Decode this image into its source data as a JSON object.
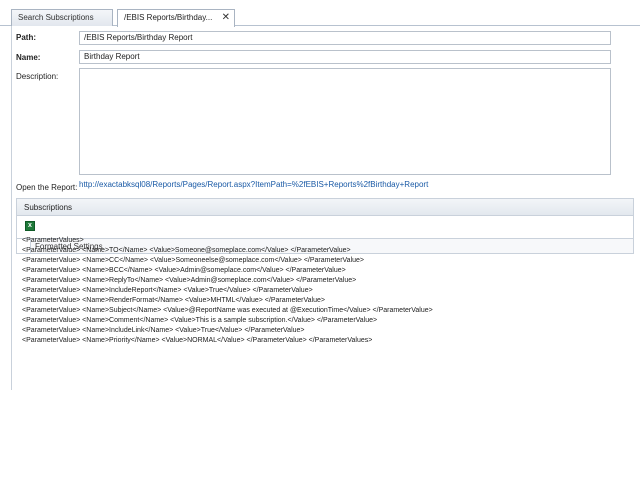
{
  "tabs": {
    "inactive_label": "Search Subscriptions",
    "active_label": "/EBIS Reports/Birthday...",
    "close_glyph": "✕"
  },
  "form": {
    "path_label": "Path:",
    "path_value": "/EBIS Reports/Birthday Report",
    "name_label": "Name:",
    "name_value": "Birthday Report",
    "description_label": "Description:",
    "description_value": "",
    "open_report_label": "Open the Report:",
    "open_report_url": "http://exactabksql08/Reports/Pages/Report.aspx?ItemPath=%2fEBIS+Reports%2fBirthday+Report"
  },
  "subscriptions": {
    "header": "Subscriptions",
    "export_icon": "excel-export-icon",
    "column_title": "Formatted Settings",
    "xml_lines": [
      "<ParameterValues>",
      "<ParameterValue> <Name>TO</Name> <Value>Someone@someplace.com</Value> </ParameterValue>",
      "<ParameterValue> <Name>CC</Name> <Value>Someoneelse@someplace.com</Value> </ParameterValue>",
      "<ParameterValue> <Name>BCC</Name> <Value>Admin@someplace.com</Value> </ParameterValue>",
      "<ParameterValue> <Name>ReplyTo</Name> <Value>Admin@someplace.com</Value> </ParameterValue>",
      "<ParameterValue> <Name>IncludeReport</Name> <Value>True</Value> </ParameterValue>",
      "<ParameterValue> <Name>RenderFormat</Name> <Value>MHTML</Value> </ParameterValue>",
      "<ParameterValue> <Name>Subject</Name> <Value>@ReportName was executed at @ExecutionTime</Value> </ParameterValue>",
      "<ParameterValue> <Name>Comment</Name> <Value>This is a sample subscription.</Value> </ParameterValue>",
      "<ParameterValue> <Name>IncludeLink</Name> <Value>True</Value> </ParameterValue>",
      "<ParameterValue> <Name>Priority</Name> <Value>NORMAL</Value> </ParameterValue> </ParameterValues>"
    ]
  }
}
